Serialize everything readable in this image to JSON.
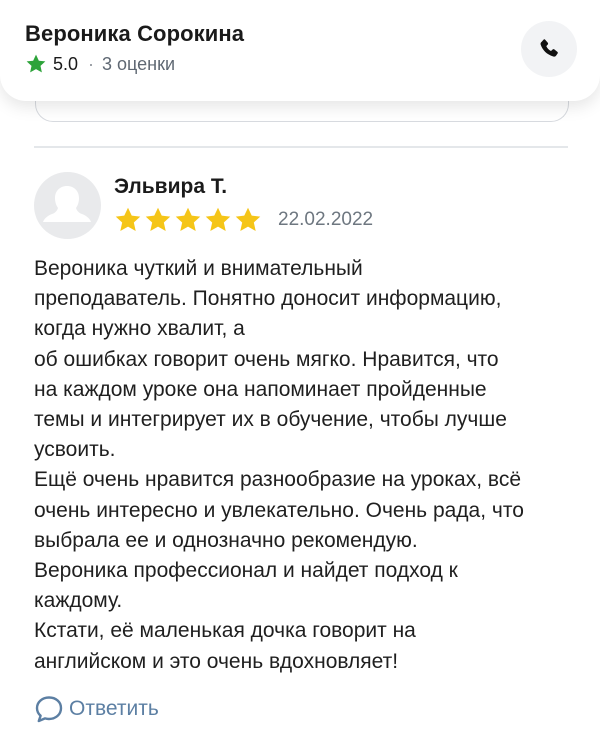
{
  "header": {
    "name": "Вероника Сорокина",
    "rating": "5.0",
    "separator": "·",
    "ratings_count": "3 оценки",
    "star_color": "#2da33a"
  },
  "review": {
    "author": "Эльвира Т.",
    "stars": 5,
    "star_color": "#f5c518",
    "date": "22.02.2022",
    "text": "Вероника чуткий и внимательный\nпреподаватель. Понятно доносит информацию,\nкогда нужно хвалит, а\nоб ошибках говорит очень мягко. Нравится, что\nна каждом уроке она напоминает пройденные\nтемы и интегрирует их в обучение, чтобы лучше\nусвоить.\nЕщё очень нравится разнообразие на уроках, всё\nочень интересно и увлекательно. Очень рада, что\nвыбрала ее и однозначно рекомендую.\nВероника профессионал и найдет подход к\nкаждому.\nКстати, её маленькая дочка говорит на\nанглийском и это очень вдохновляет!",
    "reply_label": "Ответить",
    "reply_color": "#5c7fa3"
  }
}
